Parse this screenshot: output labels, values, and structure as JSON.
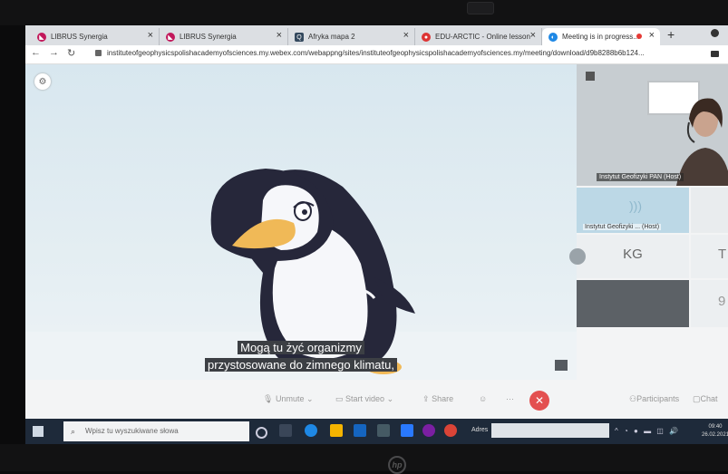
{
  "tabs": [
    {
      "title": "LIBRUS Synergia",
      "icon": "librus-icon"
    },
    {
      "title": "LIBRUS Synergia",
      "icon": "librus-icon"
    },
    {
      "title": "Afryka mapa 2",
      "icon": "quizlet-icon"
    },
    {
      "title": "EDU-ARCTIC - Online lesson",
      "icon": "edu-arctic-icon"
    },
    {
      "title": "Meeting is in progress...",
      "icon": "webex-icon"
    }
  ],
  "address": {
    "url": "instituteofgeophysicspolishacademyofsciences.my.webex.com/webappng/sites/instituteofgeophysicspolishacademyofsciences.my/meeting/download/d9b8288b6b124..."
  },
  "video": {
    "caption_line1": "Mogą tu żyć organizmy",
    "caption_line2": "przystosowane do zimnego klimatu,"
  },
  "participants": {
    "host_label": "Instytut Geofizyki PAN (Host)",
    "audio_label": "Instytut Geofizyki ... (Host)",
    "kg_initials": "KG",
    "t_initial": "T",
    "nine_initial": "9"
  },
  "controls": {
    "unmute": "Unmute",
    "start_video": "Start video",
    "share": "Share",
    "participants": "Participants",
    "chat": "Chat"
  },
  "taskbar": {
    "search_placeholder": "Wpisz tu wyszukiwane słowa",
    "address_label": "Adres",
    "time": "09:40",
    "date": "26.02.2021"
  },
  "brand": {
    "hp": "hp"
  },
  "colors": {
    "end_call": "#e35050",
    "taskbar": "#1e2a3a",
    "caption_bg": "#3c3f44"
  }
}
